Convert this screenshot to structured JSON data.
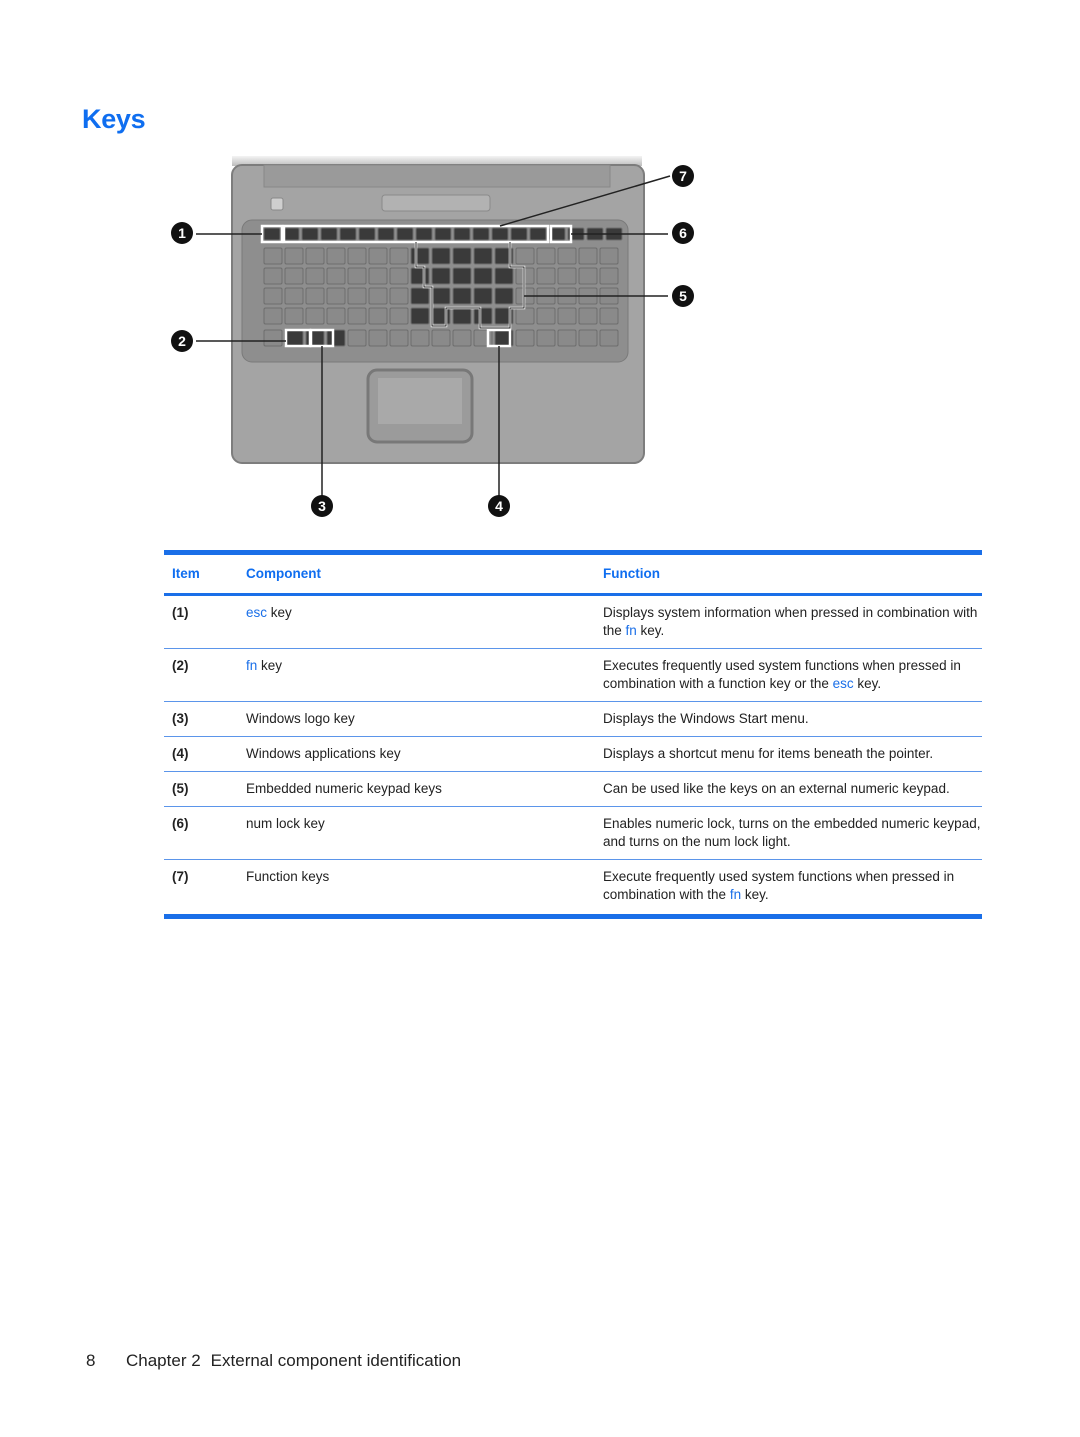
{
  "page": {
    "title": "Keys",
    "footer": {
      "page_number": "8",
      "chapter": "Chapter 2",
      "section": "External component identification"
    }
  },
  "figure": {
    "description": "Laptop keyboard top view with numbered callouts",
    "callouts": [
      "1",
      "2",
      "3",
      "4",
      "5",
      "6",
      "7"
    ]
  },
  "table": {
    "headers": {
      "item": "Item",
      "component": "Component",
      "function": "Function"
    },
    "rows": [
      {
        "item": "(1)",
        "component_link": "esc",
        "component_rest": " key",
        "function_parts": [
          "Displays system information when pressed in combination with the ",
          "fn",
          " key."
        ]
      },
      {
        "item": "(2)",
        "component_link": "fn",
        "component_rest": " key",
        "function_parts": [
          "Executes frequently used system functions when pressed in combination with a function key or the ",
          "esc",
          " key."
        ]
      },
      {
        "item": "(3)",
        "component_link": "",
        "component_rest": "Windows logo key",
        "function_parts": [
          "Displays the Windows Start menu.",
          "",
          ""
        ]
      },
      {
        "item": "(4)",
        "component_link": "",
        "component_rest": "Windows applications key",
        "function_parts": [
          "Displays a shortcut menu for items beneath the pointer.",
          "",
          ""
        ]
      },
      {
        "item": "(5)",
        "component_link": "",
        "component_rest": "Embedded numeric keypad keys",
        "function_parts": [
          "Can be used like the keys on an external numeric keypad.",
          "",
          ""
        ]
      },
      {
        "item": "(6)",
        "component_link": "",
        "component_rest": "num lock key",
        "function_parts": [
          "Enables numeric lock, turns on the embedded numeric keypad, and turns on the num lock light.",
          "",
          ""
        ]
      },
      {
        "item": "(7)",
        "component_link": "",
        "component_rest": "Function keys",
        "function_parts": [
          "Execute frequently used system functions when pressed in combination with the ",
          "fn",
          " key."
        ]
      }
    ]
  },
  "colors": {
    "accent": "#1a6fe8",
    "title": "#0f6ef0"
  }
}
